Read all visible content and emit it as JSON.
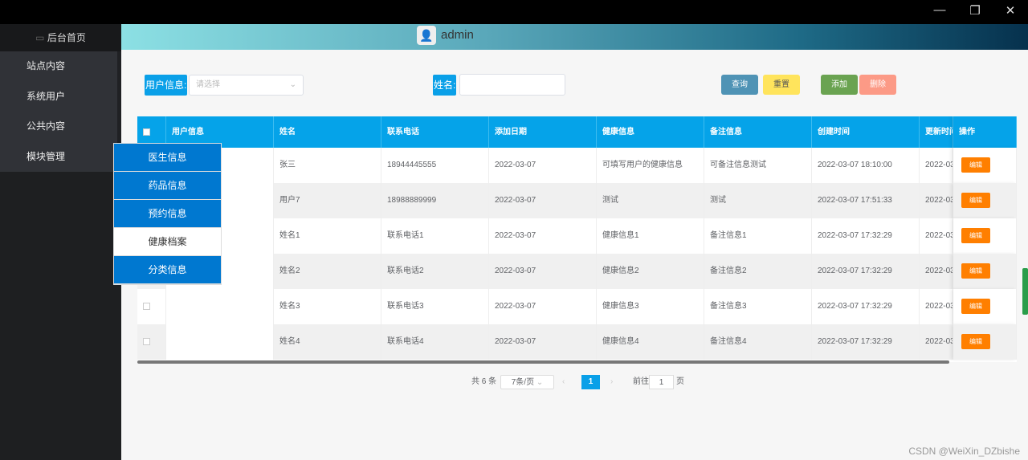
{
  "window": {
    "minimize": "—",
    "maximize": "❐",
    "close": "✕"
  },
  "sidebar": {
    "home": "后台首页",
    "items": [
      {
        "label": "站点内容"
      },
      {
        "label": "系统用户"
      },
      {
        "label": "公共内容"
      },
      {
        "label": "模块管理"
      }
    ]
  },
  "header": {
    "username": "admin"
  },
  "dropdown": {
    "items": [
      {
        "label": "医生信息"
      },
      {
        "label": "药品信息"
      },
      {
        "label": "预约信息"
      },
      {
        "label": "健康档案"
      },
      {
        "label": "分类信息"
      }
    ],
    "active": 3
  },
  "search": {
    "user_label": "用户信息:",
    "user_placeholder": "请选择",
    "name_label": "姓名:",
    "name_value": ""
  },
  "buttons": {
    "query": "查询",
    "reset": "重置",
    "add": "添加",
    "delete": "删除"
  },
  "table": {
    "headers": [
      "用户信息",
      "姓名",
      "联系电话",
      "添加日期",
      "健康信息",
      "备注信息",
      "创建时间",
      "更新时间",
      "操作"
    ],
    "edit_label": "编辑",
    "rows": [
      {
        "user": "",
        "name": "张三",
        "phone": "18944445555",
        "date": "2022-03-07",
        "health": "可填写用户的健康信息",
        "note": "可备注信息测试",
        "created": "2022-03-07 18:10:00",
        "updated": "2022-03"
      },
      {
        "user": "",
        "name": "用户7",
        "phone": "18988889999",
        "date": "2022-03-07",
        "health": "测试",
        "note": "测试",
        "created": "2022-03-07 17:51:33",
        "updated": "2022-03"
      },
      {
        "user": "",
        "name": "姓名1",
        "phone": "联系电话1",
        "date": "2022-03-07",
        "health": "健康信息1",
        "note": "备注信息1",
        "created": "2022-03-07 17:32:29",
        "updated": "2022-03"
      },
      {
        "user": "",
        "name": "姓名2",
        "phone": "联系电话2",
        "date": "2022-03-07",
        "health": "健康信息2",
        "note": "备注信息2",
        "created": "2022-03-07 17:32:29",
        "updated": "2022-03"
      },
      {
        "user": "",
        "name": "姓名3",
        "phone": "联系电话3",
        "date": "2022-03-07",
        "health": "健康信息3",
        "note": "备注信息3",
        "created": "2022-03-07 17:32:29",
        "updated": "2022-03"
      },
      {
        "user": "",
        "name": "姓名4",
        "phone": "联系电话4",
        "date": "2022-03-07",
        "health": "健康信息4",
        "note": "备注信息4",
        "created": "2022-03-07 17:32:29",
        "updated": "2022-03"
      }
    ]
  },
  "pagination": {
    "total": "共 6 条",
    "page_size": "7条/页",
    "current": "1",
    "goto_label": "前往",
    "goto_value": "1",
    "page_suffix": "页"
  },
  "watermark": "CSDN @WeiXin_DZbishe",
  "colors": {
    "accent": "#05a3e9",
    "edit": "#ff7f00",
    "menu": "#0078d0"
  }
}
